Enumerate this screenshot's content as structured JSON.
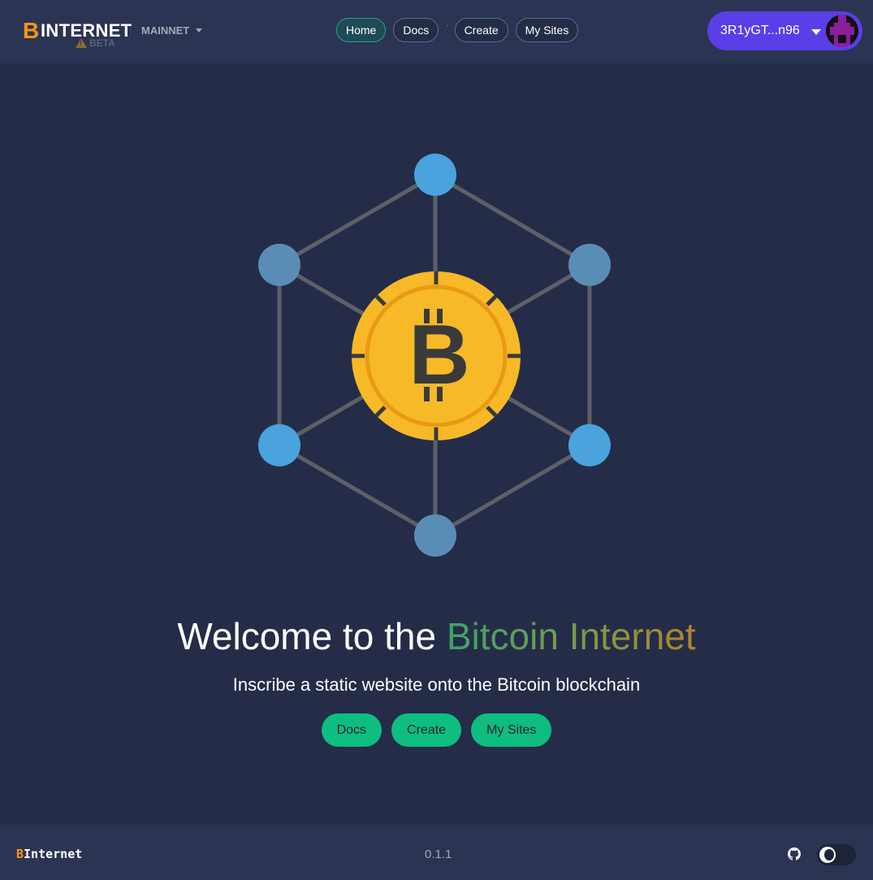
{
  "header": {
    "logo_letter": "B",
    "logo_text": "INTERNET",
    "beta_label": "BETA",
    "network_label": "MAINNET",
    "nav": [
      {
        "label": "Home",
        "active": true
      },
      {
        "label": "Docs",
        "active": false
      },
      {
        "label": "Create",
        "active": false
      },
      {
        "label": "My Sites",
        "active": false
      }
    ],
    "nav_separator": "·",
    "wallet_address": "3R1yGT...n96"
  },
  "hero": {
    "title_prefix": "Welcome to the ",
    "title_highlight": "Bitcoin Internet",
    "subtitle": "Inscribe a static website onto the Bitcoin blockchain",
    "buttons": [
      "Docs",
      "Create",
      "My Sites"
    ]
  },
  "footer": {
    "brand_letter": "B",
    "brand_text": "Internet",
    "version": "0.1.1"
  },
  "colors": {
    "background": "#252c48",
    "navbar": "#2b3453",
    "accent_green": "#0ebd80",
    "wallet_purple": "#5a3ee8",
    "bitcoin_orange": "#f7931a",
    "coin_yellow": "#f7b928",
    "node_blue": "#4aa3dc"
  },
  "icons": [
    "warning-icon",
    "chevron-down-icon",
    "avatar-identicon",
    "bitcoin-network-illustration",
    "github-icon",
    "moon-icon"
  ]
}
